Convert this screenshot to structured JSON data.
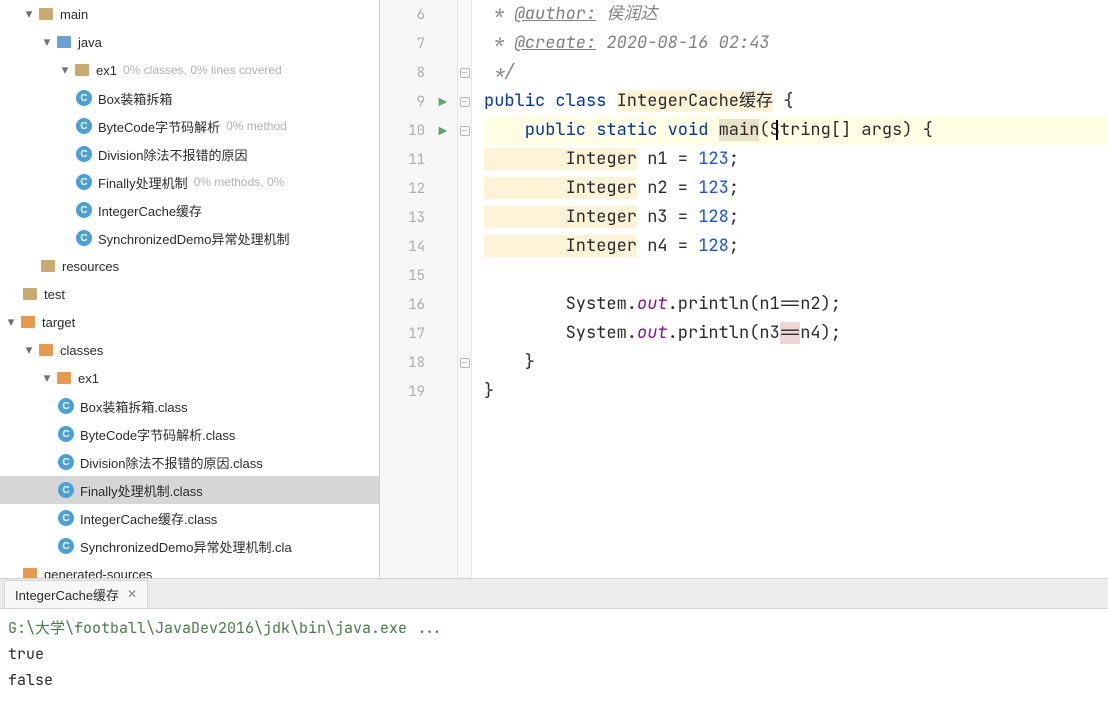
{
  "tree": {
    "main": {
      "label": "main"
    },
    "java": {
      "label": "java"
    },
    "ex1": {
      "label": "ex1",
      "hint": "0% classes, 0% lines covered"
    },
    "box": {
      "label": "Box装箱拆箱"
    },
    "bytecode": {
      "label": "ByteCode字节码解析",
      "hint": "0% method"
    },
    "division": {
      "label": "Division除法不报错的原因"
    },
    "finally": {
      "label": "Finally处理机制",
      "hint": "0% methods, 0%"
    },
    "integercache": {
      "label": "IntegerCache缓存"
    },
    "syncdemo": {
      "label": "SynchronizedDemo异常处理机制"
    },
    "resources": {
      "label": "resources"
    },
    "test": {
      "label": "test"
    },
    "target": {
      "label": "target"
    },
    "classes": {
      "label": "classes"
    },
    "ex1classes": {
      "label": "ex1"
    },
    "boxcls": {
      "label": "Box装箱拆箱.class"
    },
    "bytecodecls": {
      "label": "ByteCode字节码解析.class"
    },
    "divisioncls": {
      "label": "Division除法不报错的原因.class"
    },
    "finallycls": {
      "label": "Finally处理机制.class"
    },
    "integercachecls": {
      "label": "IntegerCache缓存.class"
    },
    "syncdemocls": {
      "label": "SynchronizedDemo异常处理机制.cla"
    },
    "gensources": {
      "label": "generated-sources"
    }
  },
  "code": {
    "l6": " * @author: 侯润达",
    "l6_star": " * ",
    "l6_ann": "@author:",
    "l6_rest": " 侯润达",
    "l7_star": " * ",
    "l7_ann": "@create:",
    "l7_rest": " 2020-08-16 02:43",
    "l8": " */",
    "l9_a": "public",
    "l9_b": " class ",
    "l9_c": "IntegerCache缓存",
    "l9_d": " {",
    "l10_a": "    public",
    "l10_b": " static ",
    "l10_c": "void ",
    "l10_d": "main",
    "l10_e": "(String[] args) {",
    "l11_a": "        Integer",
    "l11_b": " n1 = ",
    "l11_c": "123",
    "l11_d": ";",
    "l12_a": "        Integer",
    "l12_b": " n2 = ",
    "l12_c": "123",
    "l12_d": ";",
    "l13_a": "        Integer",
    "l13_b": " n3 = ",
    "l13_c": "128",
    "l13_d": ";",
    "l14_a": "        Integer",
    "l14_b": " n4 = ",
    "l14_c": "128",
    "l14_d": ";",
    "l16_a": "        System.",
    "l16_b": "out",
    "l16_c": ".println(n1==n2);",
    "l17_a": "        System.",
    "l17_b": "out",
    "l17_c": ".println(n3",
    "l17_d": "==",
    "l17_e": "n4);",
    "l18": "    }",
    "l19": "}"
  },
  "lineNumbers": [
    "6",
    "7",
    "8",
    "9",
    "10",
    "11",
    "12",
    "13",
    "14",
    "15",
    "16",
    "17",
    "18",
    "19"
  ],
  "console": {
    "tab": "IntegerCache缓存",
    "path": "G:\\大学\\football\\JavaDev2016\\jdk\\bin\\java.exe ...",
    "line1": "true",
    "line2": "false"
  }
}
